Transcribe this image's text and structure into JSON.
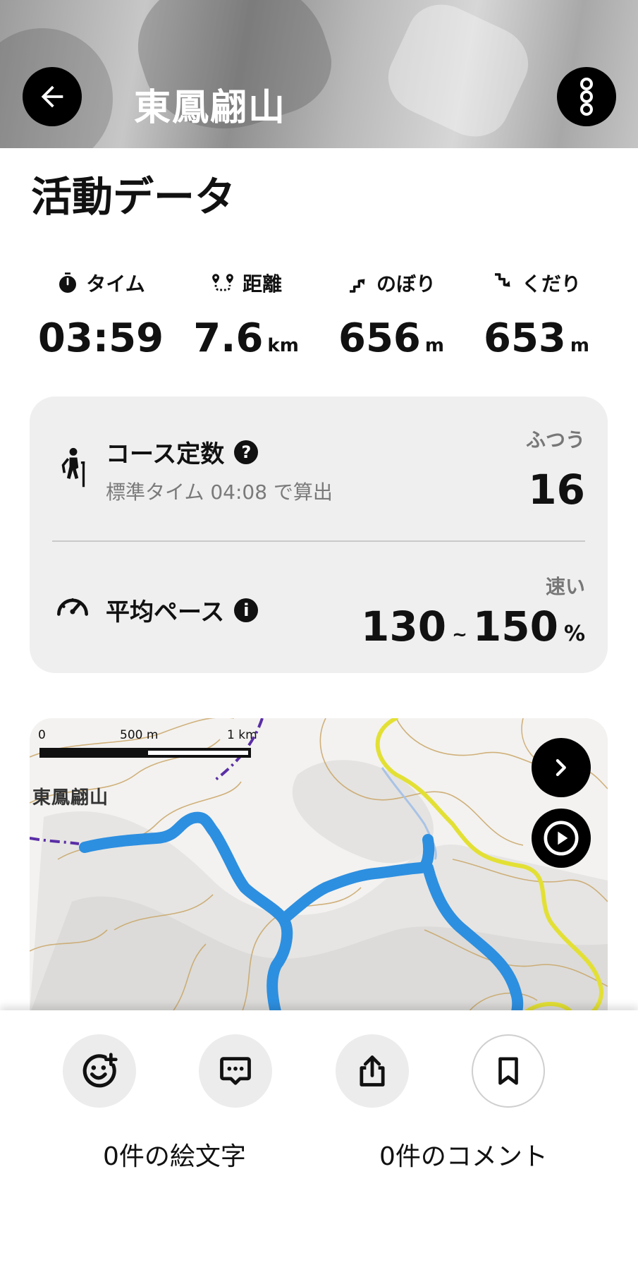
{
  "header": {
    "title": "東鳳翩山"
  },
  "section_title": "活動データ",
  "stats": [
    {
      "label": "タイム",
      "value": "03:59",
      "unit": "",
      "icon": "stopwatch-icon"
    },
    {
      "label": "距離",
      "value": "7.6",
      "unit": "km",
      "icon": "route-pin-icon"
    },
    {
      "label": "のぼり",
      "value": "656",
      "unit": "m",
      "icon": "ascent-arrow-icon"
    },
    {
      "label": "くだり",
      "value": "653",
      "unit": "m",
      "icon": "descent-arrow-icon"
    }
  ],
  "course": {
    "title": "コース定数",
    "help_glyph": "?",
    "subtitle": "標準タイム 04:08 で算出",
    "grade": "ふつう",
    "value": "16"
  },
  "pace": {
    "title": "平均ペース",
    "info_glyph": "i",
    "grade": "速い",
    "min": "130",
    "separator": "~",
    "max": "150",
    "unit": "%"
  },
  "map": {
    "scale_labels": [
      "0",
      "500 m",
      "1 km"
    ],
    "peak_name": "東鳳翩山",
    "route_color": "#2d8fe0",
    "road_color": "#e3e035",
    "trail_color": "#5a2ea6"
  },
  "actions": {
    "emoji_count_label": "0件の絵文字",
    "comment_count_label": "0件のコメント"
  }
}
